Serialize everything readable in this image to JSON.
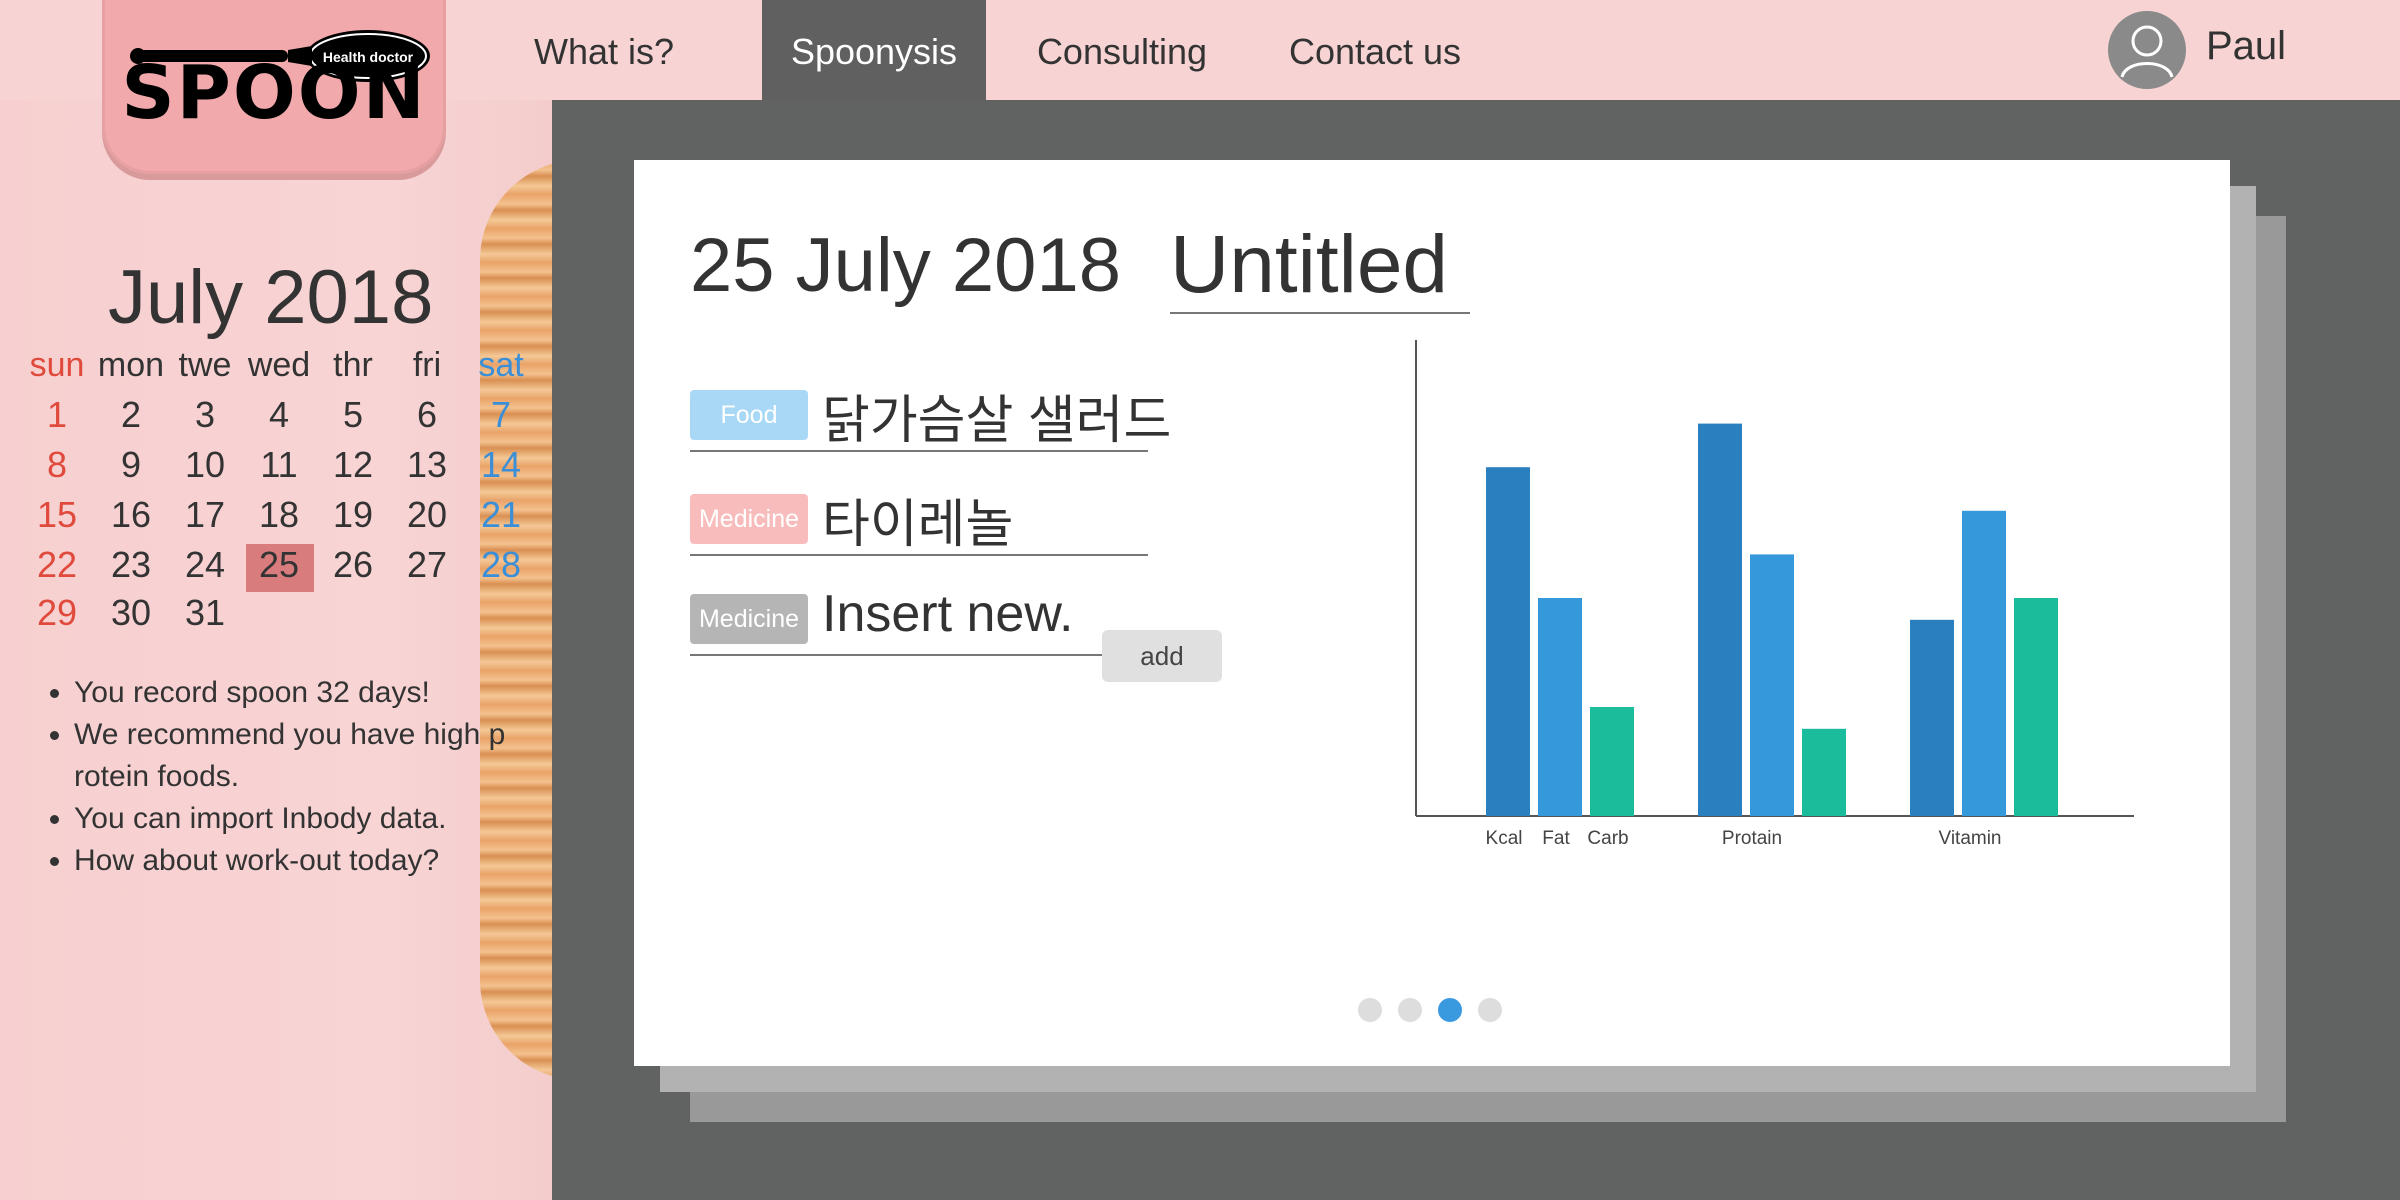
{
  "logo": {
    "badge": "Health doctor",
    "wordmark": "SPOON"
  },
  "nav": {
    "items": [
      {
        "label": "What is?"
      },
      {
        "label": "Spoonysis",
        "active": true
      },
      {
        "label": "Consulting"
      },
      {
        "label": "Contact us"
      }
    ],
    "active_color": "#606060"
  },
  "user": {
    "name": "Paul",
    "avatar_icon": "user-avatar-icon"
  },
  "calendar": {
    "title": "July 2018",
    "weekdays": [
      "sun",
      "mon",
      "twe",
      "wed",
      "thr",
      "fri",
      "sat"
    ],
    "weeks": [
      [
        "1",
        "2",
        "3",
        "4",
        "5",
        "6",
        "7"
      ],
      [
        "8",
        "9",
        "10",
        "11",
        "12",
        "13",
        "14"
      ],
      [
        "15",
        "16",
        "17",
        "18",
        "19",
        "20",
        "21"
      ],
      [
        "22",
        "23",
        "24",
        "25",
        "26",
        "27",
        "28"
      ],
      [
        "29",
        "30",
        "31",
        "",
        "",
        "",
        ""
      ]
    ],
    "selected_day": "25",
    "sunday_color": "#e04a3c",
    "saturday_color": "#3a8fd8",
    "selected_color": "#d97c7e"
  },
  "tips": [
    "You record spoon 32 days!",
    "We recommend you have high p rotein foods.",
    "You can import Inbody data.",
    "How about work-out today?"
  ],
  "card": {
    "date": "25 July 2018",
    "title": "Untitled",
    "entries": [
      {
        "tag": "Food",
        "text": "닭가슴살 샐러드",
        "tag_color": "#a8d8f5"
      },
      {
        "tag": "Medicine",
        "text": "타이레놀",
        "tag_color": "#f9bcbc"
      },
      {
        "tag": "Medicine",
        "text": "Insert new.",
        "tag_color": "#b5b5b5"
      }
    ],
    "add_label": "add",
    "pagination": {
      "total": 4,
      "current": 3
    }
  },
  "chart_data": {
    "type": "bar",
    "categories": [
      "Kcal",
      "Fat",
      "Carb",
      "Protain",
      "Vitamin"
    ],
    "series": [
      {
        "values": [
          80,
          90,
          45
        ],
        "color": "#2a7fbf"
      },
      {
        "values": [
          50,
          60,
          70
        ],
        "color": "#3498db"
      },
      {
        "values": [
          25,
          20,
          50
        ],
        "color": "#1abc9c"
      }
    ],
    "groups": [
      {
        "label_keys": [
          "Kcal",
          "Fat",
          "Carb"
        ]
      },
      {
        "label_keys": [
          "Protain"
        ]
      },
      {
        "label_keys": [
          "Vitamin"
        ]
      }
    ],
    "ylim": [
      0,
      100
    ],
    "grid": false,
    "legend": "none"
  }
}
